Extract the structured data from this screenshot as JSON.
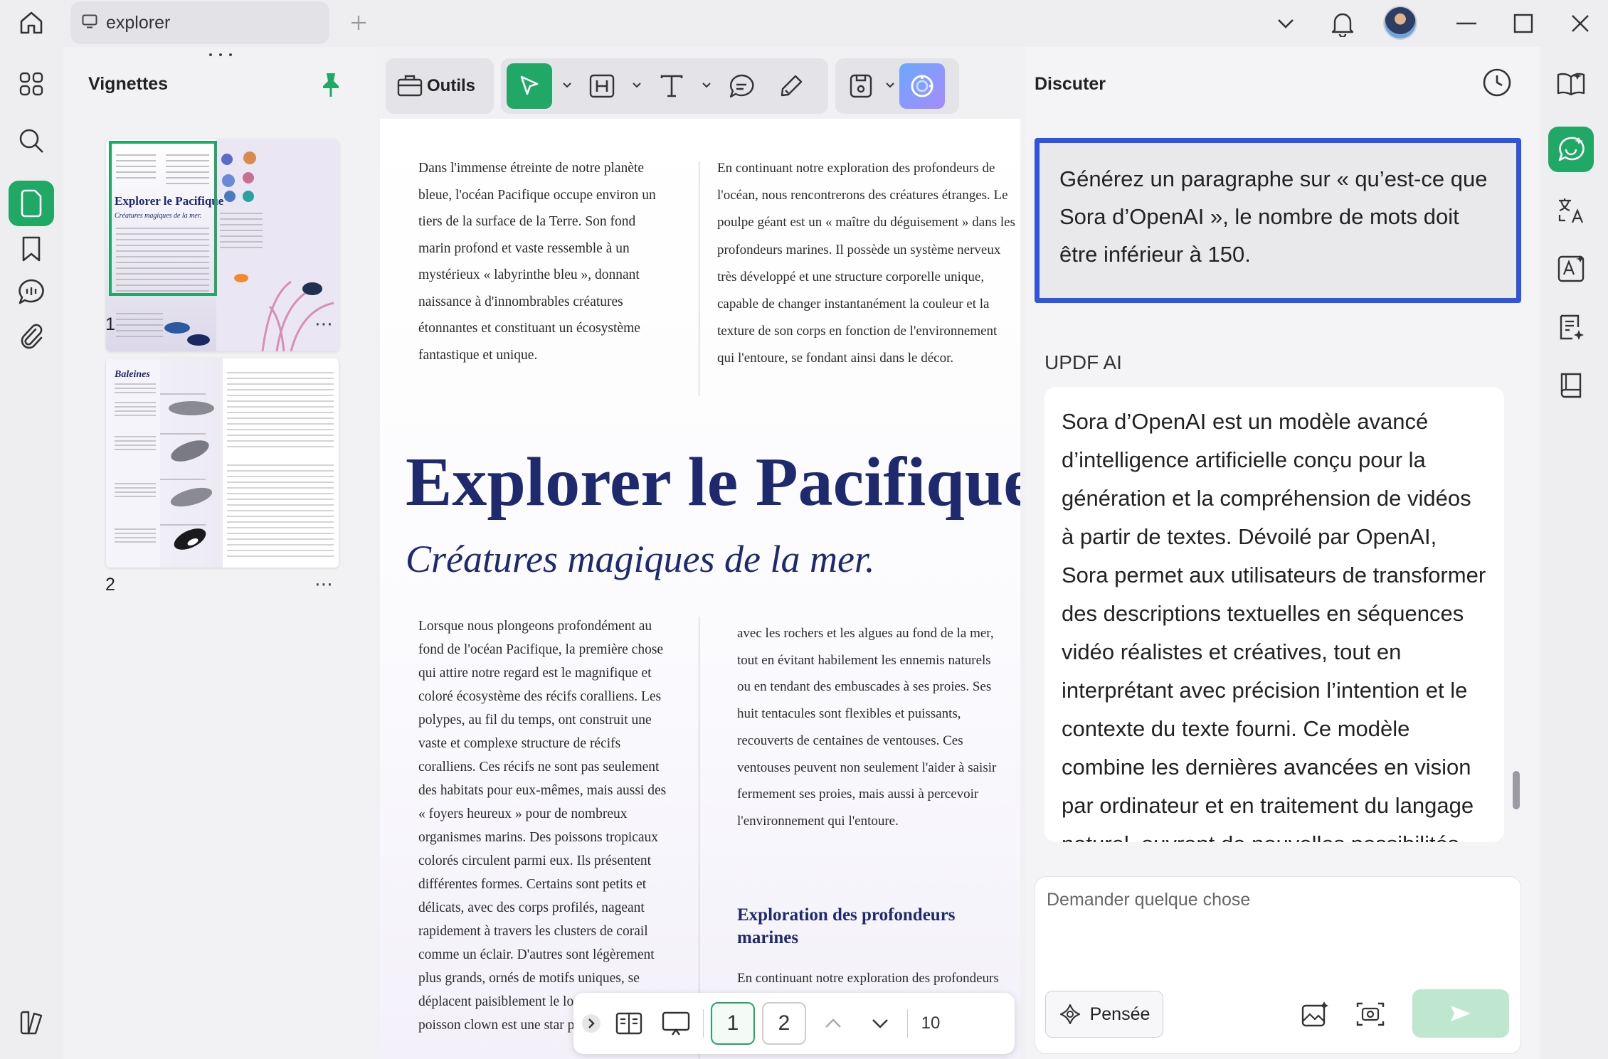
{
  "titlebar": {
    "tab_title": "explorer"
  },
  "thumbnails": {
    "title": "Vignettes",
    "pages": [
      {
        "number": "1",
        "more": "⋯"
      },
      {
        "number": "2",
        "more": "⋯"
      }
    ],
    "thumb1": {
      "title": "Explorer le Pacifique",
      "subtitle": "Créatures magiques de la mer."
    },
    "thumb2": {
      "title": "Baleines"
    }
  },
  "toolbar": {
    "tools_label": "Outils"
  },
  "document": {
    "intro_left": "Dans l'immense étreinte de notre planète bleue, l'océan Pacifique occupe environ un tiers de la surface de la Terre. Son fond marin profond et vaste ressemble à un mystérieux « labyrinthe bleu », donnant naissance à d'innombrables créatures étonnantes et constituant un écosystème fantastique et unique.",
    "intro_right": "En continuant notre exploration des profondeurs de l'océan, nous rencontrerons des créatures étranges. Le poulpe géant est un « maître du déguisement » dans les profondeurs marines. Il possède un système nerveux très développé et une structure corporelle unique, capable de changer instantanément la couleur et la texture de son corps en fonction de l'environnement qui l'entoure, se fondant ainsi dans le décor.",
    "title": "Explorer le Pacifique",
    "subtitle": "Créatures magiques de la mer.",
    "body_left": "Lorsque nous plongeons profondément au fond de l'océan Pacifique, la première chose qui attire notre regard est le magnifique et coloré écosystème des récifs coralliens. Les polypes, au fil du temps, ont construit une vaste et complexe structure de récifs coralliens. Ces récifs ne sont pas seulement des habitats pour eux-mêmes, mais aussi des « foyers heureux » pour de nombreux organismes marins. Des poissons tropicaux colorés circulent parmi eux. Ils présentent différentes formes. Certains sont petits et délicats, avec des corps profilés, nageant rapidement à travers les clusters de corail comme un éclair. D'autres sont légèrement plus grands, ornés de motifs uniques, se déplacent paisiblement le long du récif. Le poisson clown est une star parmi",
    "body_right": "avec les rochers et les algues au fond de la mer, tout en évitant habilement les ennemis naturels ou en tendant des embuscades à ses proies. Ses huit tentacules sont flexibles et puissants, recouverts de centaines de ventouses. Ces ventouses peuvent non seulement l'aider à saisir fermement ses proies, mais aussi à percevoir l'environnement qui l'entoure.",
    "section_heading": "Exploration des profondeurs marines",
    "section_body": "En continuant notre exploration des profondeurs marines, nous rencontrerons des"
  },
  "pagenav": {
    "page1": "1",
    "page2": "2",
    "zoom": "10"
  },
  "chat": {
    "title": "Discuter",
    "prompt": "Générez un paragraphe sur « qu’est-ce que Sora d’OpenAI », le nombre de mots doit être inférieur à 150.",
    "ai_label": "UPDF AI",
    "ai_response": "Sora d’OpenAI est un modèle avancé d’intelligence artificielle conçu pour la génération et la compréhension de vidéos à partir de textes. Dévoilé par OpenAI, Sora permet aux utilisateurs de transformer des descriptions textuelles en séquences vidéo réalistes et créatives, tout en interprétant avec précision l’intention et le contexte du texte fourni. Ce modèle combine les dernières avancées en vision par ordinateur et en traitement du langage naturel, ouvrant de nouvelles possibilités dans la",
    "input_placeholder": "Demander quelque chose",
    "think_label": "Pensée"
  },
  "colors": {
    "accent": "#21a866",
    "highlight_border": "#2f55e0",
    "doc_title": "#1f2a6e"
  }
}
